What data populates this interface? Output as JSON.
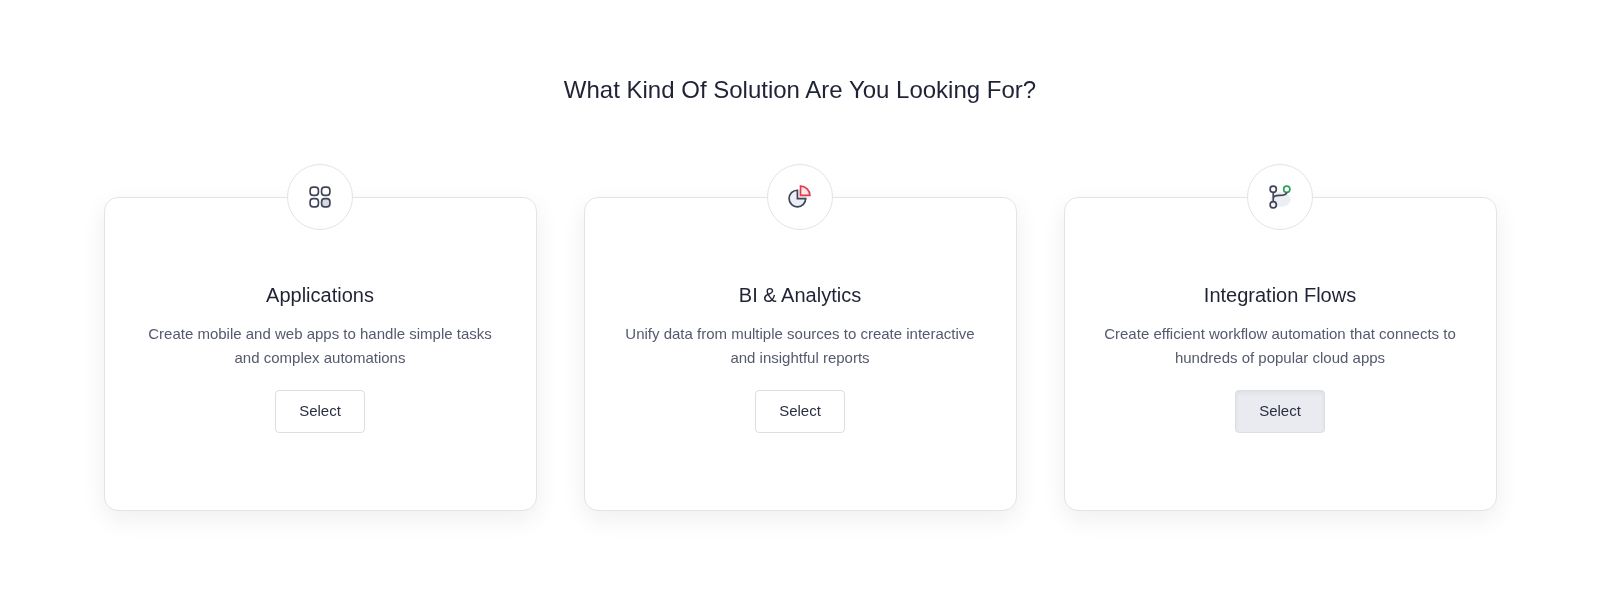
{
  "heading": "What Kind Of Solution Are You Looking For?",
  "cards": [
    {
      "kind": "grid",
      "title": "Applications",
      "description": "Create mobile and web apps to handle simple tasks and complex automations",
      "button": "Select",
      "hovered": false
    },
    {
      "kind": "pie",
      "title": "BI & Analytics",
      "description": "Unify data from multiple sources to create interactive and insightful reports",
      "button": "Select",
      "hovered": false
    },
    {
      "kind": "branch",
      "title": "Integration Flows",
      "description": "Create efficient workflow automation that connects to hundreds of popular cloud apps",
      "button": "Select",
      "hovered": true
    }
  ]
}
